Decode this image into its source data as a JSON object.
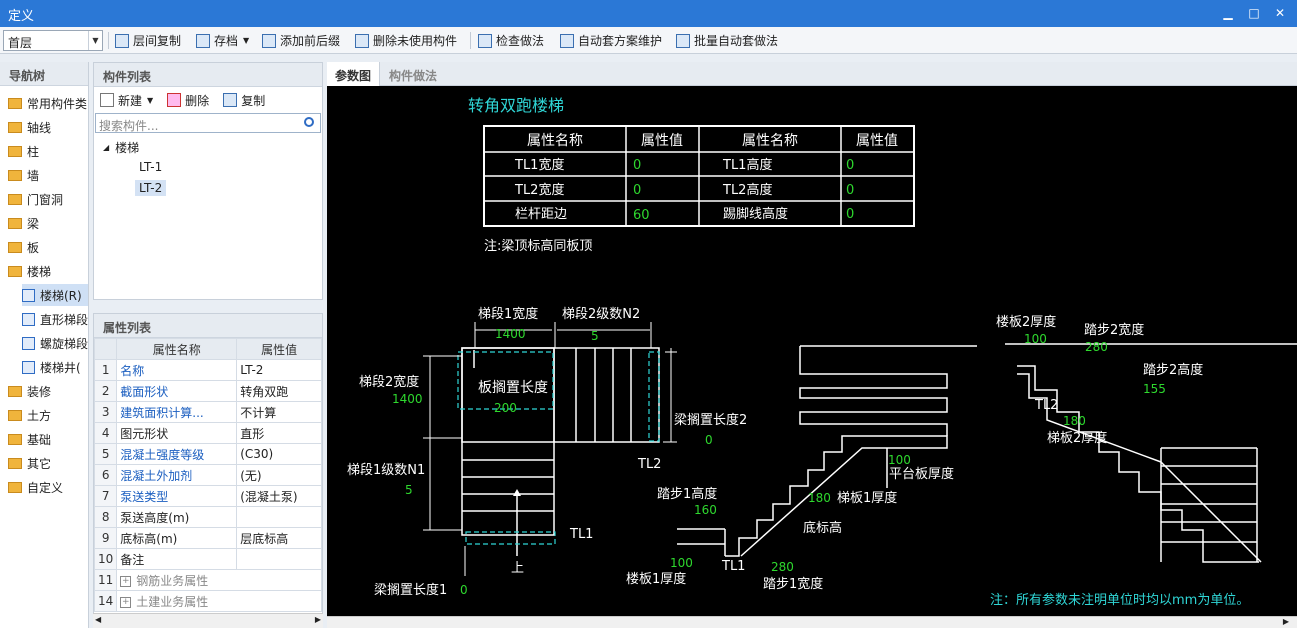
{
  "window": {
    "title": "定义"
  },
  "toolbar": {
    "floor": "首层",
    "items": [
      "层间复制",
      "存档",
      "添加前后缀",
      "删除未使用构件",
      "检查做法",
      "自动套方案维护",
      "批量自动套做法"
    ]
  },
  "nav": {
    "title": "导航树",
    "items": [
      "常用构件类",
      "轴线",
      "柱",
      "墙",
      "门窗洞",
      "梁",
      "板",
      "楼梯",
      "楼梯(R)",
      "直形梯段",
      "螺旋梯段",
      "楼梯井(",
      "装修",
      "土方",
      "基础",
      "其它",
      "自定义"
    ]
  },
  "components": {
    "title": "构件列表",
    "new_label": "新建",
    "delete_label": "删除",
    "copy_label": "复制",
    "search_placeholder": "搜索构件...",
    "tree_root": "楼梯",
    "children": [
      "LT-1",
      "LT-2"
    ]
  },
  "properties": {
    "title": "属性列表",
    "col_name": "属性名称",
    "col_value": "属性值",
    "rows": [
      {
        "no": "1",
        "name": "名称",
        "value": "LT-2"
      },
      {
        "no": "2",
        "name": "截面形状",
        "value": "转角双跑"
      },
      {
        "no": "3",
        "name": "建筑面积计算...",
        "value": "不计算"
      },
      {
        "no": "4",
        "name": "图元形状",
        "value": "直形"
      },
      {
        "no": "5",
        "name": "混凝土强度等级",
        "value": "(C30)"
      },
      {
        "no": "6",
        "name": "混凝土外加剂",
        "value": "(无)"
      },
      {
        "no": "7",
        "name": "泵送类型",
        "value": "(混凝土泵)"
      },
      {
        "no": "8",
        "name": "泵送高度(m)",
        "value": ""
      },
      {
        "no": "9",
        "name": "底标高(m)",
        "value": "层底标高"
      },
      {
        "no": "10",
        "name": "备注",
        "value": ""
      },
      {
        "no": "11",
        "name": "钢筋业务属性",
        "value": ""
      },
      {
        "no": "14",
        "name": "土建业务属性",
        "value": ""
      }
    ]
  },
  "tabs": [
    "参数图",
    "构件做法"
  ],
  "drawing": {
    "title": "转角双跑楼梯",
    "table_head": [
      "属性名称",
      "属性值",
      "属性名称",
      "属性值"
    ],
    "table_rows": [
      [
        "TL1宽度",
        "0",
        "TL1高度",
        "0"
      ],
      [
        "TL2宽度",
        "0",
        "TL2高度",
        "0"
      ],
      [
        "栏杆距边",
        "60",
        "踢脚线高度",
        "0"
      ]
    ],
    "note_beam": "注:梁顶标高同板顶",
    "labels": {
      "run1_width": "梯段1宽度",
      "run1_width_v": "1400",
      "run2_steps": "梯段2级数N2",
      "run2_steps_v": "5",
      "run2_width": "梯段2宽度",
      "run2_width_v": "1400",
      "slab_seat": "板搁置长度",
      "slab_seat_v": "200",
      "beam_seat2": "梁搁置长度2",
      "beam_seat2_v": "0",
      "run1_steps": "梯段1级数N1",
      "run1_steps_v": "5",
      "tl2": "TL2",
      "tl1": "TL1",
      "up": "上",
      "beam_seat1": "梁搁置长度1",
      "beam_seat1_v": "0",
      "step1_h": "踏步1高度",
      "step1_h_v": "160",
      "flight1_t": "梯板1厚度",
      "flight1_t_v": "180",
      "platform_t": "平台板厚度",
      "platform_t_v": "100",
      "bottom_elev": "底标高",
      "slab1_t": "楼板1厚度",
      "slab1_t_v": "100",
      "step1_w": "踏步1宽度",
      "step1_w_v": "280",
      "slab2_t": "楼板2厚度",
      "slab2_t_v": "100",
      "step2_w": "踏步2宽度",
      "step2_w_v": "280",
      "step2_h": "踏步2高度",
      "step2_h_v": "155",
      "flight2_t": "梯板2厚度",
      "flight2_t_v": "180"
    },
    "footer_note": "注：所有参数未注明单位时均以mm为单位。"
  }
}
